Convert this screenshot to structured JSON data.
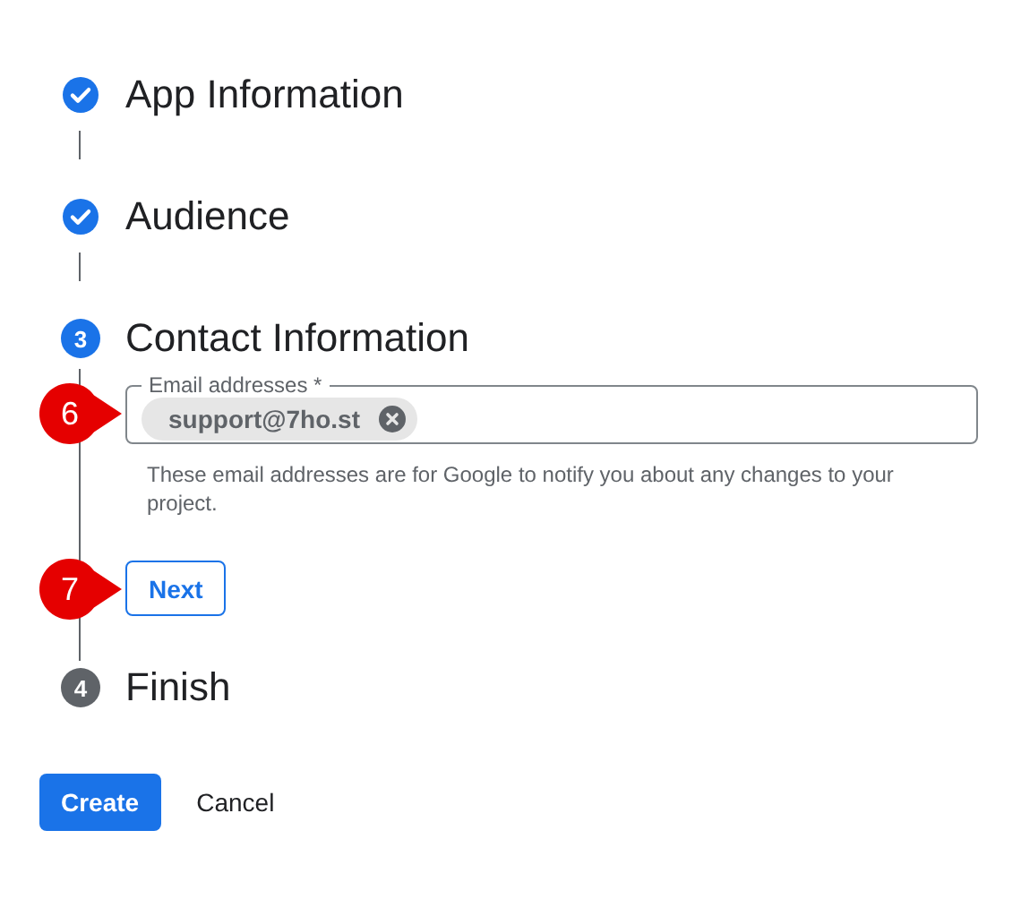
{
  "steps": [
    {
      "title": "App Information",
      "kind": "done"
    },
    {
      "title": "Audience",
      "kind": "done"
    },
    {
      "number": "3",
      "title": "Contact Information",
      "kind": "active",
      "field": {
        "label": "Email addresses *",
        "chips": [
          "support@7ho.st"
        ],
        "hint": "These email addresses are for Google to notify you about any changes to your project.",
        "callout": "6"
      },
      "button": {
        "label": "Next",
        "callout": "7"
      }
    },
    {
      "number": "4",
      "title": "Finish",
      "kind": "pending"
    }
  ],
  "buttons": [
    {
      "label": "Create",
      "kind": "primary"
    },
    {
      "label": "Cancel",
      "kind": "text"
    }
  ]
}
